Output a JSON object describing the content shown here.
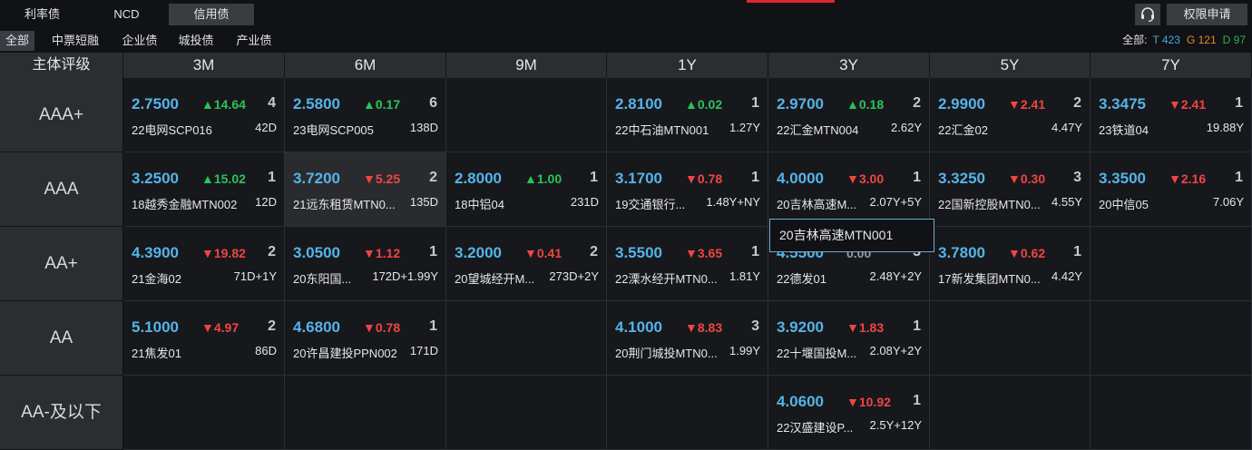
{
  "top_tabs": [
    {
      "label": "利率债",
      "active": false
    },
    {
      "label": "NCD",
      "active": false
    },
    {
      "label": "信用债",
      "active": true
    }
  ],
  "header_right": {
    "support_icon": "headset-icon",
    "apply_label": "权限申请"
  },
  "sub_tabs": [
    {
      "label": "全部",
      "active": true
    },
    {
      "label": "中票短融",
      "active": false
    },
    {
      "label": "企业债",
      "active": false
    },
    {
      "label": "城投债",
      "active": false
    },
    {
      "label": "产业债",
      "active": false
    }
  ],
  "summary": {
    "label": "全部:",
    "t": "T 423",
    "g": "G 121",
    "d": "D 97"
  },
  "grid": {
    "corner": "主体评级",
    "columns": [
      "3M",
      "6M",
      "9M",
      "1Y",
      "3Y",
      "5Y",
      "7Y"
    ],
    "rows": [
      {
        "rating": "AAA+",
        "cells": [
          {
            "rate": "2.7500",
            "chg": "▲14.64",
            "dir": "up",
            "count": "4",
            "name": "22电网SCP016",
            "term": "42D"
          },
          {
            "rate": "2.5800",
            "chg": "▲0.17",
            "dir": "up",
            "count": "6",
            "name": "23电网SCP005",
            "term": "138D"
          },
          null,
          {
            "rate": "2.8100",
            "chg": "▲0.02",
            "dir": "up",
            "count": "1",
            "name": "22中石油MTN001",
            "term": "1.27Y"
          },
          {
            "rate": "2.9700",
            "chg": "▲0.18",
            "dir": "up",
            "count": "2",
            "name": "22汇金MTN004",
            "term": "2.62Y"
          },
          {
            "rate": "2.9900",
            "chg": "▼2.41",
            "dir": "down",
            "count": "2",
            "name": "22汇金02",
            "term": "4.47Y"
          },
          {
            "rate": "3.3475",
            "chg": "▼2.41",
            "dir": "down",
            "count": "1",
            "name": "23铁道04",
            "term": "19.88Y"
          }
        ]
      },
      {
        "rating": "AAA",
        "cells": [
          {
            "rate": "3.2500",
            "chg": "▲15.02",
            "dir": "up",
            "count": "1",
            "name": "18越秀金融MTN002",
            "term": "12D"
          },
          {
            "rate": "3.7200",
            "chg": "▼5.25",
            "dir": "down",
            "count": "2",
            "name": "21远东租赁MTN0...",
            "term": "135D",
            "highlight": true
          },
          {
            "rate": "2.8000",
            "chg": "▲1.00",
            "dir": "up",
            "count": "1",
            "name": "18中铝04",
            "term": "231D"
          },
          {
            "rate": "3.1700",
            "chg": "▼0.78",
            "dir": "down",
            "count": "1",
            "name": "19交通银行...",
            "term": "1.48Y+NY"
          },
          {
            "rate": "4.0000",
            "chg": "▼3.00",
            "dir": "down",
            "count": "1",
            "name": "20吉林高速M...",
            "term": "2.07Y+5Y"
          },
          {
            "rate": "3.3250",
            "chg": "▼0.30",
            "dir": "down",
            "count": "3",
            "name": "22国新控股MTN0...",
            "term": "4.55Y"
          },
          {
            "rate": "3.3500",
            "chg": "▼2.16",
            "dir": "down",
            "count": "1",
            "name": "20中信05",
            "term": "7.06Y"
          }
        ]
      },
      {
        "rating": "AA+",
        "cells": [
          {
            "rate": "4.3900",
            "chg": "▼19.82",
            "dir": "down",
            "count": "2",
            "name": "21金海02",
            "term": "71D+1Y"
          },
          {
            "rate": "3.0500",
            "chg": "▼1.12",
            "dir": "down",
            "count": "1",
            "name": "20东阳国...",
            "term": "172D+1.99Y"
          },
          {
            "rate": "3.2000",
            "chg": "▼0.41",
            "dir": "down",
            "count": "2",
            "name": "20望城经开M...",
            "term": "273D+2Y"
          },
          {
            "rate": "3.5500",
            "chg": "▼3.65",
            "dir": "down",
            "count": "1",
            "name": "22溧水经开MTN0...",
            "term": "1.81Y"
          },
          {
            "rate": "4.5500",
            "chg": "0.00",
            "dir": "flat",
            "count": "3",
            "name": "22德发01",
            "term": "2.48Y+2Y"
          },
          {
            "rate": "3.7800",
            "chg": "▼0.62",
            "dir": "down",
            "count": "1",
            "name": "17新发集团MTN0...",
            "term": "4.42Y"
          },
          null
        ]
      },
      {
        "rating": "AA",
        "cells": [
          {
            "rate": "5.1000",
            "chg": "▼4.97",
            "dir": "down",
            "count": "2",
            "name": "21焦发01",
            "term": "86D"
          },
          {
            "rate": "4.6800",
            "chg": "▼0.78",
            "dir": "down",
            "count": "1",
            "name": "20许昌建投PPN002",
            "term": "171D"
          },
          null,
          {
            "rate": "4.1000",
            "chg": "▼8.83",
            "dir": "down",
            "count": "3",
            "name": "20荆门城投MTN0...",
            "term": "1.99Y"
          },
          {
            "rate": "3.9200",
            "chg": "▼1.83",
            "dir": "down",
            "count": "1",
            "name": "22十堰国投M...",
            "term": "2.08Y+2Y"
          },
          null,
          null
        ]
      },
      {
        "rating": "AA-及以下",
        "cells": [
          null,
          null,
          null,
          null,
          {
            "rate": "4.0600",
            "chg": "▼10.92",
            "dir": "down",
            "count": "1",
            "name": "22汉盛建设P...",
            "term": "2.5Y+12Y"
          },
          null,
          null
        ]
      }
    ]
  },
  "tooltip": {
    "text": "20吉林高速MTN001"
  },
  "colors": {
    "rate": "#55b4e8",
    "up": "#2bc35a",
    "down": "#f04545",
    "accent": "#e0262f"
  }
}
